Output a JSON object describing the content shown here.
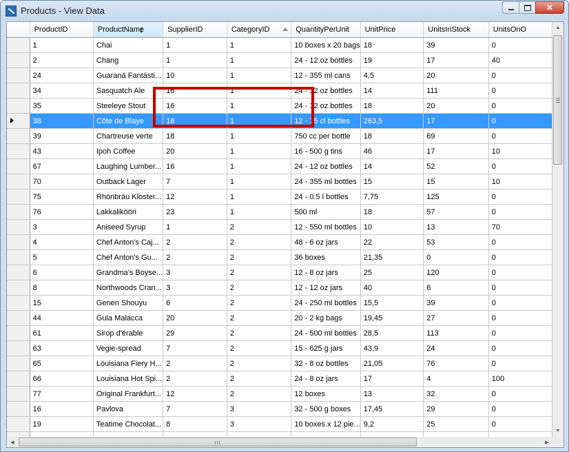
{
  "window": {
    "title": "Products - View Data"
  },
  "caption_buttons": {
    "minimize": "minimize",
    "maximize": "maximize",
    "close": "✕"
  },
  "colors": {
    "selection": "#3399ff",
    "annotation": "#c00000"
  },
  "columns": [
    "ProductID",
    "ProductName",
    "SupplierID",
    "CategoryID",
    "QuantityPerUnit",
    "UnitPrice",
    "UnitsInStock",
    "UnitsOnO"
  ],
  "selected_row_index": 5,
  "rows": [
    [
      "1",
      "Chai",
      "1",
      "1",
      "10 boxes x 20 bags",
      "18",
      "39",
      "0"
    ],
    [
      "2",
      "Chang",
      "1",
      "1",
      "24 - 12 oz bottles",
      "19",
      "17",
      "40"
    ],
    [
      "24",
      "Guaraná Fantásti...",
      "10",
      "1",
      "12 - 355 ml cans",
      "4,5",
      "20",
      "0"
    ],
    [
      "34",
      "Sasquatch Ale",
      "16",
      "1",
      "24 - 12 oz bottles",
      "14",
      "111",
      "0"
    ],
    [
      "35",
      "Steeleye Stout",
      "16",
      "1",
      "24 - 12 oz bottles",
      "18",
      "20",
      "0"
    ],
    [
      "38",
      "Côte de Blaye",
      "18",
      "1",
      "12 - 75 cl bottles",
      "263,5",
      "17",
      "0"
    ],
    [
      "39",
      "Chartreuse verte",
      "18",
      "1",
      "750 cc per bottle",
      "18",
      "69",
      "0"
    ],
    [
      "43",
      "Ipoh Coffee",
      "20",
      "1",
      "16 - 500 g tins",
      "46",
      "17",
      "10"
    ],
    [
      "67",
      "Laughing Lumber...",
      "16",
      "1",
      "24 - 12 oz bottles",
      "14",
      "52",
      "0"
    ],
    [
      "70",
      "Outback Lager",
      "7",
      "1",
      "24 - 355 ml bottles",
      "15",
      "15",
      "10"
    ],
    [
      "75",
      "Rhönbräu Kloster...",
      "12",
      "1",
      "24 - 0.5 l bottles",
      "7,75",
      "125",
      "0"
    ],
    [
      "76",
      "Lakkalikööri",
      "23",
      "1",
      "500 ml",
      "18",
      "57",
      "0"
    ],
    [
      "3",
      "Aniseed Syrup",
      "1",
      "2",
      "12 - 550 ml bottles",
      "10",
      "13",
      "70"
    ],
    [
      "4",
      "Chef Anton's Caj...",
      "2",
      "2",
      "48 - 6 oz jars",
      "22",
      "53",
      "0"
    ],
    [
      "5",
      "Chef Anton's Gu...",
      "2",
      "2",
      "36 boxes",
      "21,35",
      "0",
      "0"
    ],
    [
      "6",
      "Grandma's Boyse...",
      "3",
      "2",
      "12 - 8 oz jars",
      "25",
      "120",
      "0"
    ],
    [
      "8",
      "Northwoods Cran...",
      "3",
      "2",
      "12 - 12 oz jars",
      "40",
      "6",
      "0"
    ],
    [
      "15",
      "Genen Shouyu",
      "6",
      "2",
      "24 - 250 ml bottles",
      "15,5",
      "39",
      "0"
    ],
    [
      "44",
      "Gula Malacca",
      "20",
      "2",
      "20 - 2 kg bags",
      "19,45",
      "27",
      "0"
    ],
    [
      "61",
      "Sirop d'érable",
      "29",
      "2",
      "24 - 500 ml bottles",
      "28,5",
      "113",
      "0"
    ],
    [
      "63",
      "Vegie-spread",
      "7",
      "2",
      "15 - 625 g jars",
      "43,9",
      "24",
      "0"
    ],
    [
      "65",
      "Louisiana Fiery H...",
      "2",
      "2",
      "32 - 8 oz bottles",
      "21,05",
      "76",
      "0"
    ],
    [
      "66",
      "Louisiana Hot Spi...",
      "2",
      "2",
      "24 - 8 oz jars",
      "17",
      "4",
      "100"
    ],
    [
      "77",
      "Original Frankfurt...",
      "12",
      "2",
      "12 boxes",
      "13",
      "32",
      "0"
    ],
    [
      "16",
      "Pavlova",
      "7",
      "3",
      "32 - 500 g boxes",
      "17,45",
      "29",
      "0"
    ],
    [
      "19",
      "Teatime Chocolat...",
      "8",
      "3",
      "10 boxes x 12 pie...",
      "9,2",
      "25",
      "0"
    ],
    [
      "",
      "",
      "",
      "",
      "",
      "",
      "",
      ""
    ]
  ]
}
